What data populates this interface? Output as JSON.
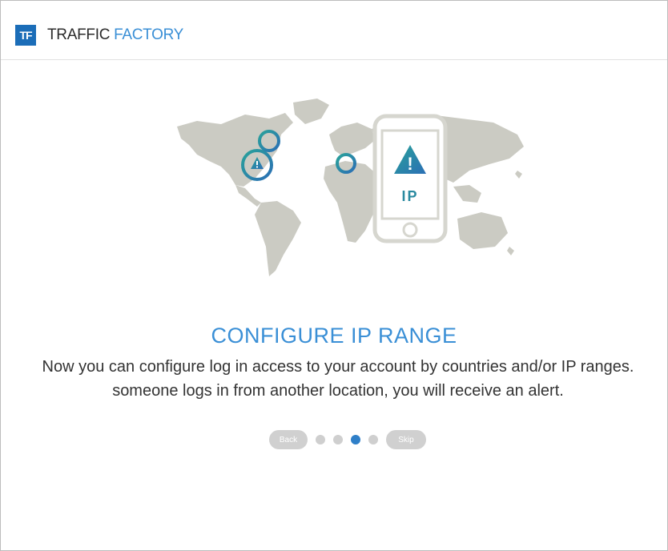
{
  "header": {
    "logo_text": "TF",
    "brand_part1": "TRAFFIC",
    "brand_part2": "FACTORY"
  },
  "illustration": {
    "phone_label": "IP",
    "alert_symbol": "!",
    "icons": [
      "world-map-icon",
      "location-ring-icon",
      "warning-icon",
      "smartphone-icon"
    ],
    "colors": {
      "map": "#cbcbc3",
      "ring_gradient_start": "#2aa29a",
      "ring_gradient_end": "#2b6fb5",
      "phone_outline": "#d6d6cf"
    }
  },
  "main": {
    "title": "CONFIGURE IP RANGE",
    "description_line1": "Now you can configure log in access to your account by countries and/or IP ranges.",
    "description_line2": "someone logs in from another location, you will receive an alert."
  },
  "pager": {
    "back_label": "Back",
    "skip_label": "Skip",
    "total_steps": 4,
    "active_step": 3
  },
  "colors": {
    "accent": "#3a8fd6",
    "brand_dark": "#1b6db8",
    "pill": "#d0d0d0"
  }
}
